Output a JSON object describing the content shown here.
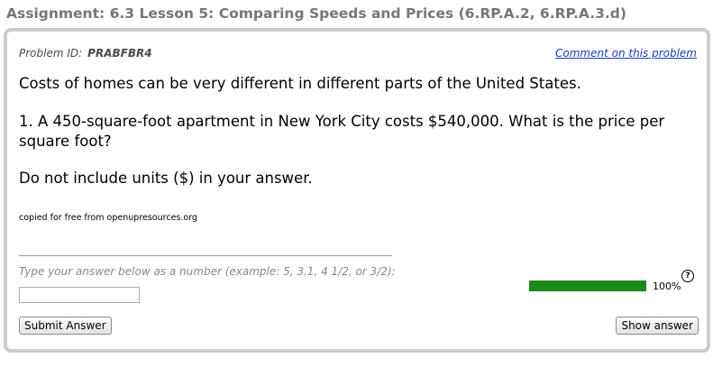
{
  "assignment": {
    "title": "Assignment: 6.3 Lesson 5: Comparing Speeds and Prices (6.RP.A.2, 6.RP.A.3.d)"
  },
  "problem": {
    "id_label": "Problem ID:",
    "id_value": "PRABFBR4",
    "comment_link": "Comment on this problem",
    "intro": "Costs of homes can be very different in different parts of the United States.",
    "question": "1. A 450-square-foot apartment in New York City costs $540,000. What is the price per square foot?",
    "instruction": "Do not include units ($) in your answer.",
    "credit": "copied for free from openupresources.org"
  },
  "answer": {
    "hint": "Type your answer below as a number (example: 5, 3.1, 4 1/2, or 3/2):",
    "value": "",
    "placeholder": ""
  },
  "progress": {
    "fraction": 1.0,
    "label": "100%",
    "fill_color": "#1a8a1a",
    "help_icon": "question-circle-icon",
    "help_symbol": "?"
  },
  "buttons": {
    "submit": "Submit Answer",
    "show": "Show answer"
  }
}
